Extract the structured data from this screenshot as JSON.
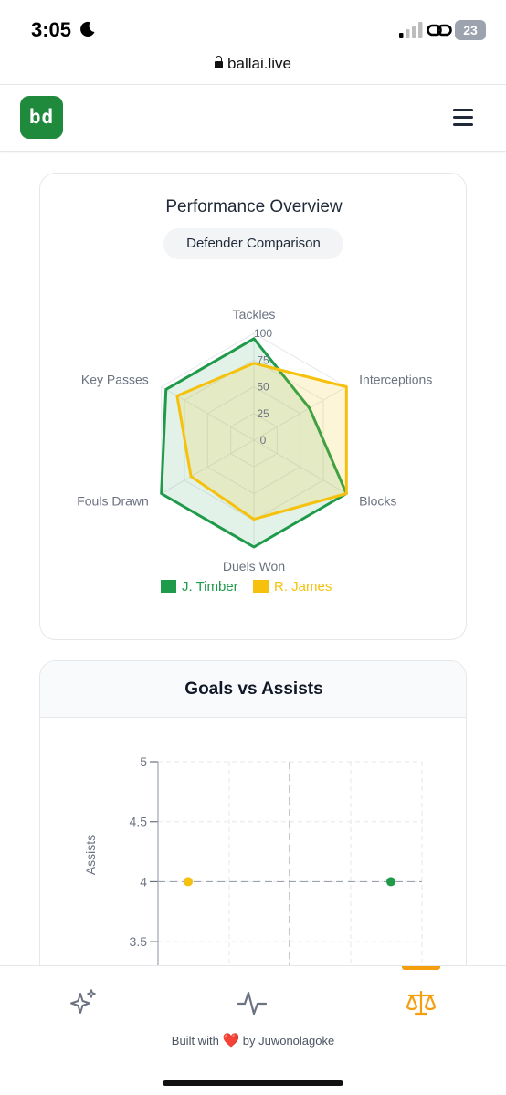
{
  "status_bar": {
    "time": "3:05",
    "battery": "23"
  },
  "url_bar": {
    "domain": "ballai.live"
  },
  "header": {
    "logo_text": "bd"
  },
  "radar_card": {
    "title": "Performance Overview",
    "badge": "Defender Comparison",
    "chart_data": {
      "type": "radar",
      "axes": [
        "Tackles",
        "Interceptions",
        "Blocks",
        "Duels Won",
        "Fouls Drawn",
        "Key Passes"
      ],
      "ticks": [
        "0",
        "25",
        "50",
        "75",
        "100"
      ],
      "rmax": 100,
      "series": [
        {
          "name": "J. Timber",
          "color": "#1f9a4a",
          "fill": "rgba(31,154,74,0.13)",
          "values": [
            95,
            60,
            100,
            100,
            100,
            95
          ]
        },
        {
          "name": "R. James",
          "color": "#f5c10d",
          "fill": "rgba(245,193,13,0.16)",
          "values": [
            72,
            100,
            100,
            74,
            68,
            83
          ]
        }
      ],
      "legend_position": "bottom"
    }
  },
  "scatter_card": {
    "title": "Goals vs Assists",
    "chart_data": {
      "type": "scatter",
      "ylabel": "Assists",
      "yticks": [
        "5",
        "4.5",
        "4",
        "3.5"
      ],
      "ylim": [
        3.25,
        5
      ],
      "points": [
        {
          "series": "R. James",
          "color": "#f5c10d",
          "y": 4
        },
        {
          "series": "J. Timber",
          "color": "#1f9a4a",
          "y": 4
        }
      ]
    }
  },
  "bottom_nav": {
    "credit_prefix": "Built with",
    "credit_heart": "❤️",
    "credit_suffix": "by Juwonolagoke",
    "active_color": "#f59e0b"
  }
}
